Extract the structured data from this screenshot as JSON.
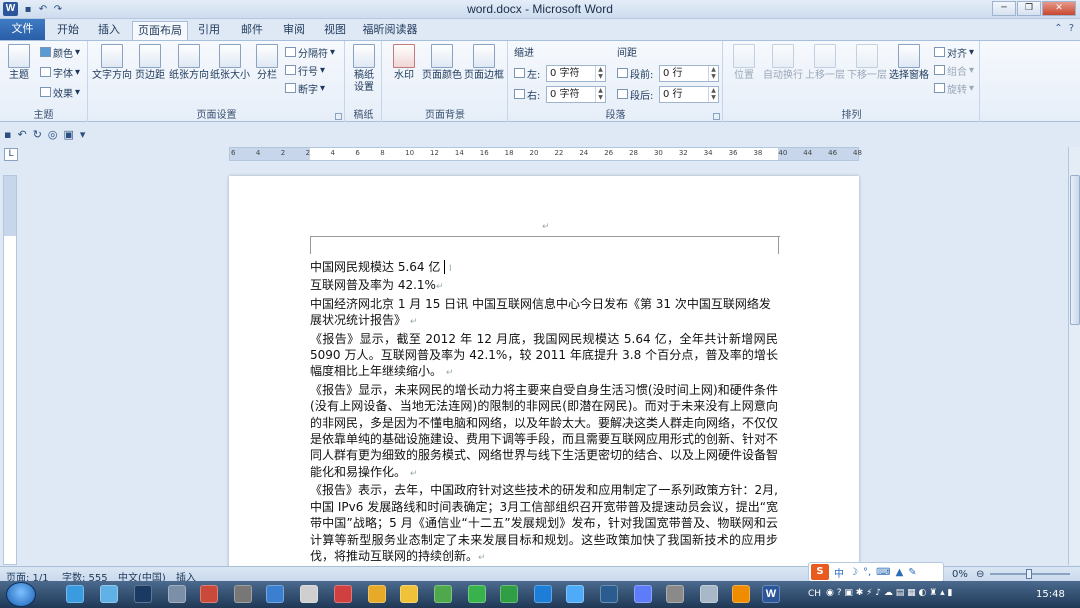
{
  "window": {
    "title": "word.docx - Microsoft Word",
    "app_icon": "W"
  },
  "tabs": [
    "文件",
    "开始",
    "插入",
    "页面布局",
    "引用",
    "邮件",
    "审阅",
    "视图",
    "福昕阅读器"
  ],
  "active_tab": "页面布局",
  "ribbon": {
    "theme": {
      "big": "主题",
      "colors": "颜色",
      "fonts": "字体",
      "effects": "效果",
      "label": "主题"
    },
    "page_setup": {
      "items": [
        "文字方向",
        "页边距",
        "纸张方向",
        "纸张大小",
        "分栏"
      ],
      "breaks": "分隔符",
      "line_numbers": "行号",
      "hyphenation": "断字",
      "label": "页面设置"
    },
    "draft": {
      "item_line1": "稿纸",
      "item_line2": "设置",
      "label": "稿纸"
    },
    "page_background": {
      "items": [
        "水印",
        "页面颜色",
        "页面边框"
      ],
      "label": "页面背景"
    },
    "paragraph": {
      "indent_title": "缩进",
      "left_label": "左:",
      "left_value": "0 字符",
      "right_label": "右:",
      "right_value": "0 字符",
      "spacing_title": "间距",
      "before_label": "段前:",
      "before_value": "0 行",
      "after_label": "段后:",
      "after_value": "0 行",
      "label": "段落"
    },
    "arrange": {
      "items": [
        "位置",
        "自动换行",
        "上移一层",
        "下移一层",
        "选择窗格"
      ],
      "align": "对齐",
      "group": "组合",
      "rotate": "旋转",
      "label": "排列"
    }
  },
  "ruler": {
    "ticks": [
      "6",
      "4",
      "2",
      "2",
      "4",
      "6",
      "8",
      "10",
      "12",
      "14",
      "16",
      "18",
      "20",
      "22",
      "24",
      "26",
      "28",
      "30",
      "32",
      "34",
      "36",
      "38",
      "40",
      "44",
      "46",
      "48"
    ]
  },
  "document": {
    "paragraphs": [
      "中国网民规模达 5.64 亿",
      "互联网普及率为 42.1%",
      "中国经济网北京 1 月 15 日讯 中国互联网信息中心今日发布《第 31 次中国互联网络发展状况统计报告》",
      "《报告》显示，截至 2012 年 12 月底，我国网民规模达 5.64 亿，全年共计新增网民 5090 万人。互联网普及率为 42.1%，较 2011 年底提升 3.8 个百分点，普及率的增长幅度相比上年继续缩小。",
      "《报告》显示，未来网民的增长动力将主要来自受自身生活习惯(没时间上网)和硬件条件(没有上网设备、当地无法连网)的限制的非网民(即潜在网民)。而对于未来没有上网意向的非网民，多是因为不懂电脑和网络，以及年龄太大。要解决这类人群走向网络，不仅仅是依靠单纯的基础设施建设、费用下调等手段，而且需要互联网应用形式的创新、针对不同人群有更为细致的服务模式、网络世界与线下生活更密切的结合、以及上网硬件设备智能化和易操作化。",
      "《报告》表示，去年，中国政府针对这些技术的研发和应用制定了一系列政策方针：2月,中国 IPv6 发展路线和时间表确定；3月工信部组织召开宽带普及提速动员会议，提出“宽带中国”战略；5 月《通信业“十二五”发展规划》发布，针对我国宽带普及、物联网和云计算等新型服务业态制定了未来发展目标和规划。这些政策加快了我国新技术的应用步伐，将推动互联网的持续创新。"
    ]
  },
  "status": {
    "page": "页面: 1/1",
    "words": "字数: 555",
    "language": "中文(中国)",
    "mode": "插入",
    "zoom": "0%"
  },
  "ime": {
    "logo": "S",
    "mode": "中"
  },
  "tray": {
    "lang": "CH",
    "time": "15:48"
  },
  "colors": {
    "file_tab": "#2a5ea8",
    "ribbon_bg": "#e6eef8",
    "taskbar": "#1f3856"
  }
}
